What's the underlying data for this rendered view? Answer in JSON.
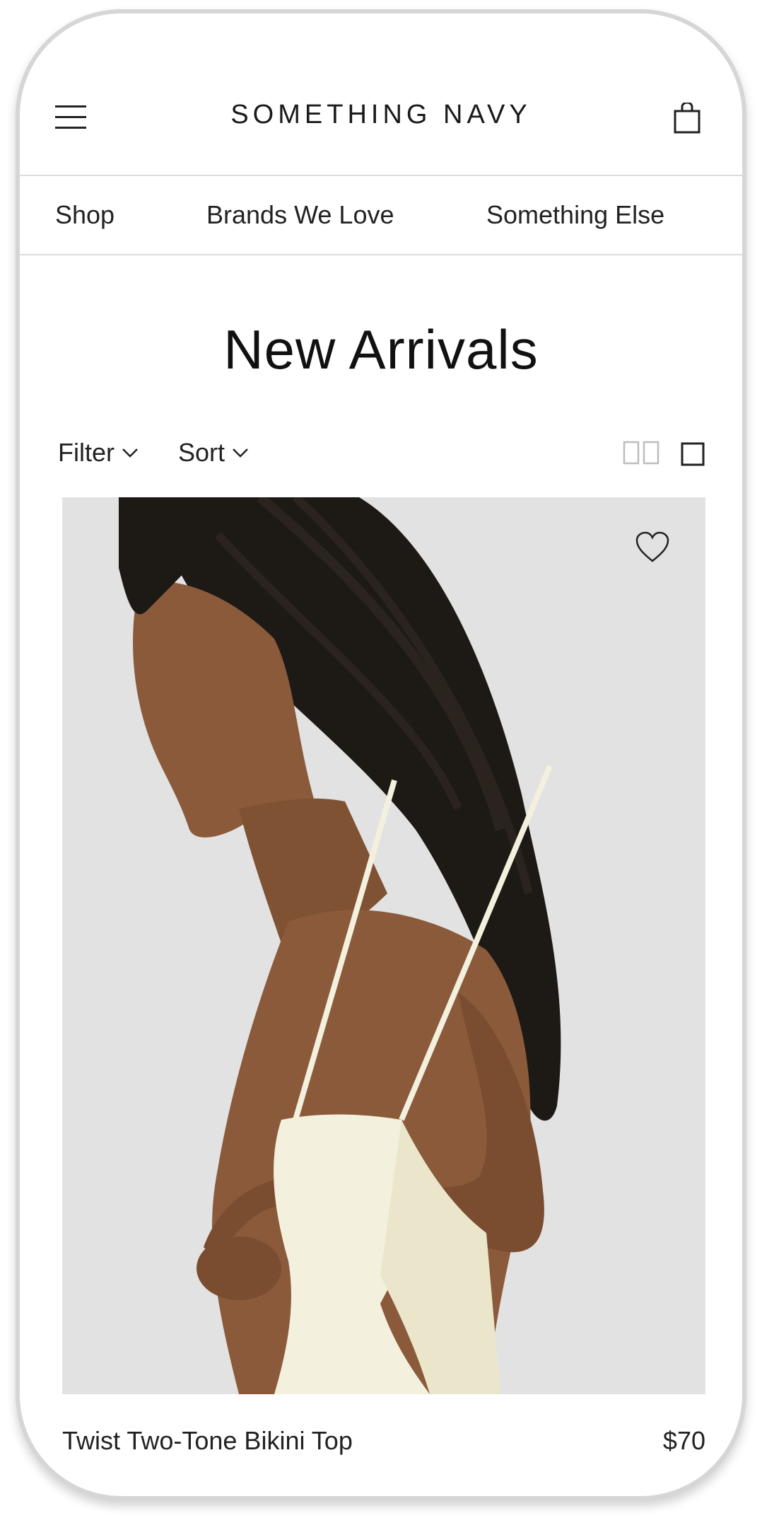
{
  "header": {
    "logo": "SOMETHING NAVY",
    "menu_icon": "hamburger-menu-icon",
    "bag_icon": "shopping-bag-icon"
  },
  "nav": {
    "items": [
      {
        "label": "Shop"
      },
      {
        "label": "Brands We Love"
      },
      {
        "label": "Something Else"
      }
    ]
  },
  "page": {
    "title": "New Arrivals"
  },
  "toolbar": {
    "filter_label": "Filter",
    "sort_label": "Sort",
    "view_two_up_icon": "two-column-grid-icon",
    "view_one_up_icon": "single-column-grid-icon"
  },
  "product": {
    "name": "Twist Two-Tone Bikini Top",
    "price": "$70",
    "wishlist_icon": "heart-icon"
  },
  "colors": {
    "text": "#222222",
    "divider": "#dcdcdc",
    "image_bg": "#e2e2e2",
    "swimsuit": "#f3f0de",
    "skin": "#8a5a3b",
    "hair": "#1d1915"
  }
}
